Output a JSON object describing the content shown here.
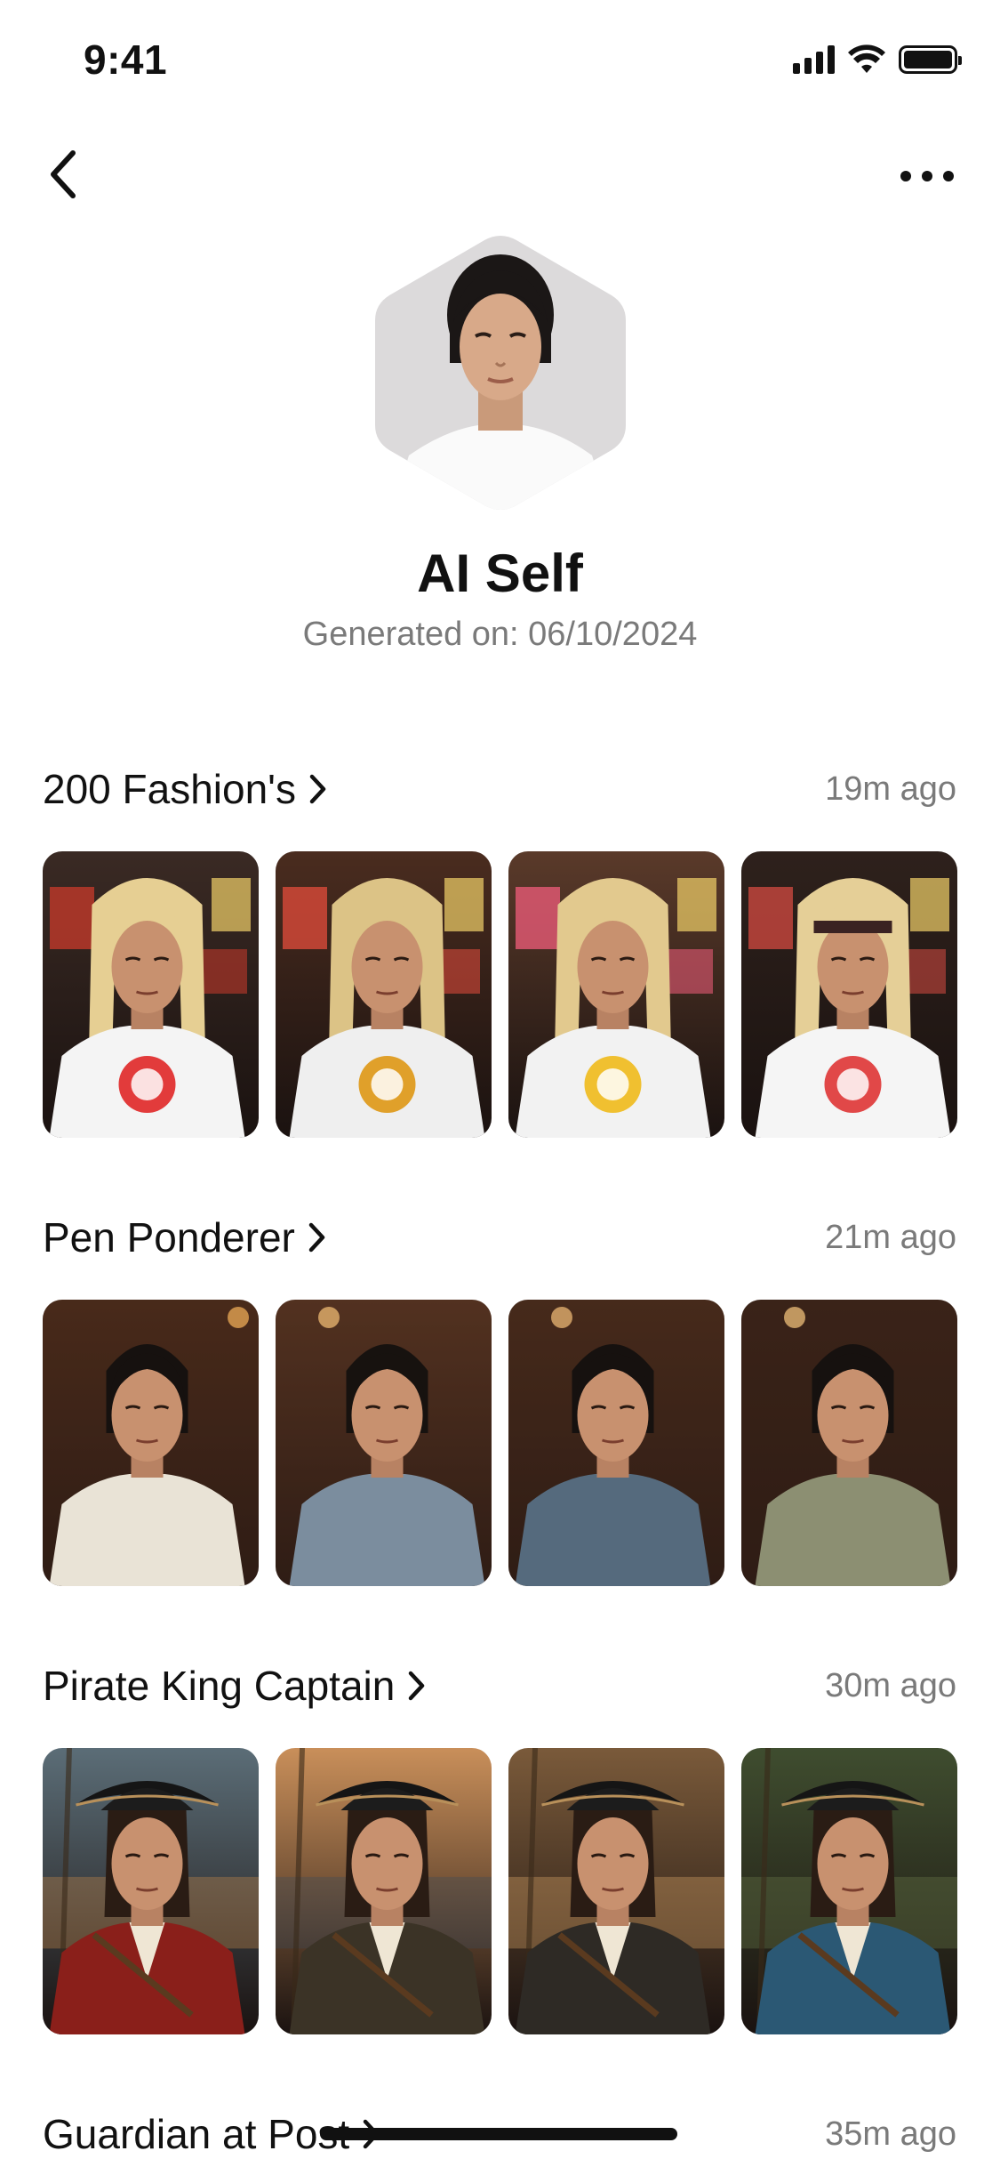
{
  "status_bar": {
    "time": "9:41",
    "icons": [
      "signal-icon",
      "wifi-icon",
      "battery-icon"
    ]
  },
  "nav": {
    "back_icon": "chevron-left-icon",
    "more_icon": "ellipsis-icon"
  },
  "profile": {
    "name": "AI Self",
    "generated_label": "Generated on: 06/10/2024"
  },
  "sections": [
    {
      "title": "200 Fashion's",
      "time": "19m ago",
      "theme": "fashion",
      "thumbs": [
        "fashion-1",
        "fashion-2",
        "fashion-3",
        "fashion-4"
      ]
    },
    {
      "title": "Pen Ponderer",
      "time": "21m ago",
      "theme": "ponderer",
      "thumbs": [
        "ponderer-1",
        "ponderer-2",
        "ponderer-3",
        "ponderer-4"
      ]
    },
    {
      "title": "Pirate King Captain",
      "time": "30m ago",
      "theme": "pirate",
      "thumbs": [
        "pirate-1",
        "pirate-2",
        "pirate-3",
        "pirate-4"
      ]
    },
    {
      "title": "Guardian at Post",
      "time": "35m ago",
      "theme": "guardian",
      "thumbs": []
    }
  ],
  "colors": {
    "text_primary": "#111111",
    "text_secondary": "#7a7a7a",
    "background": "#ffffff"
  }
}
